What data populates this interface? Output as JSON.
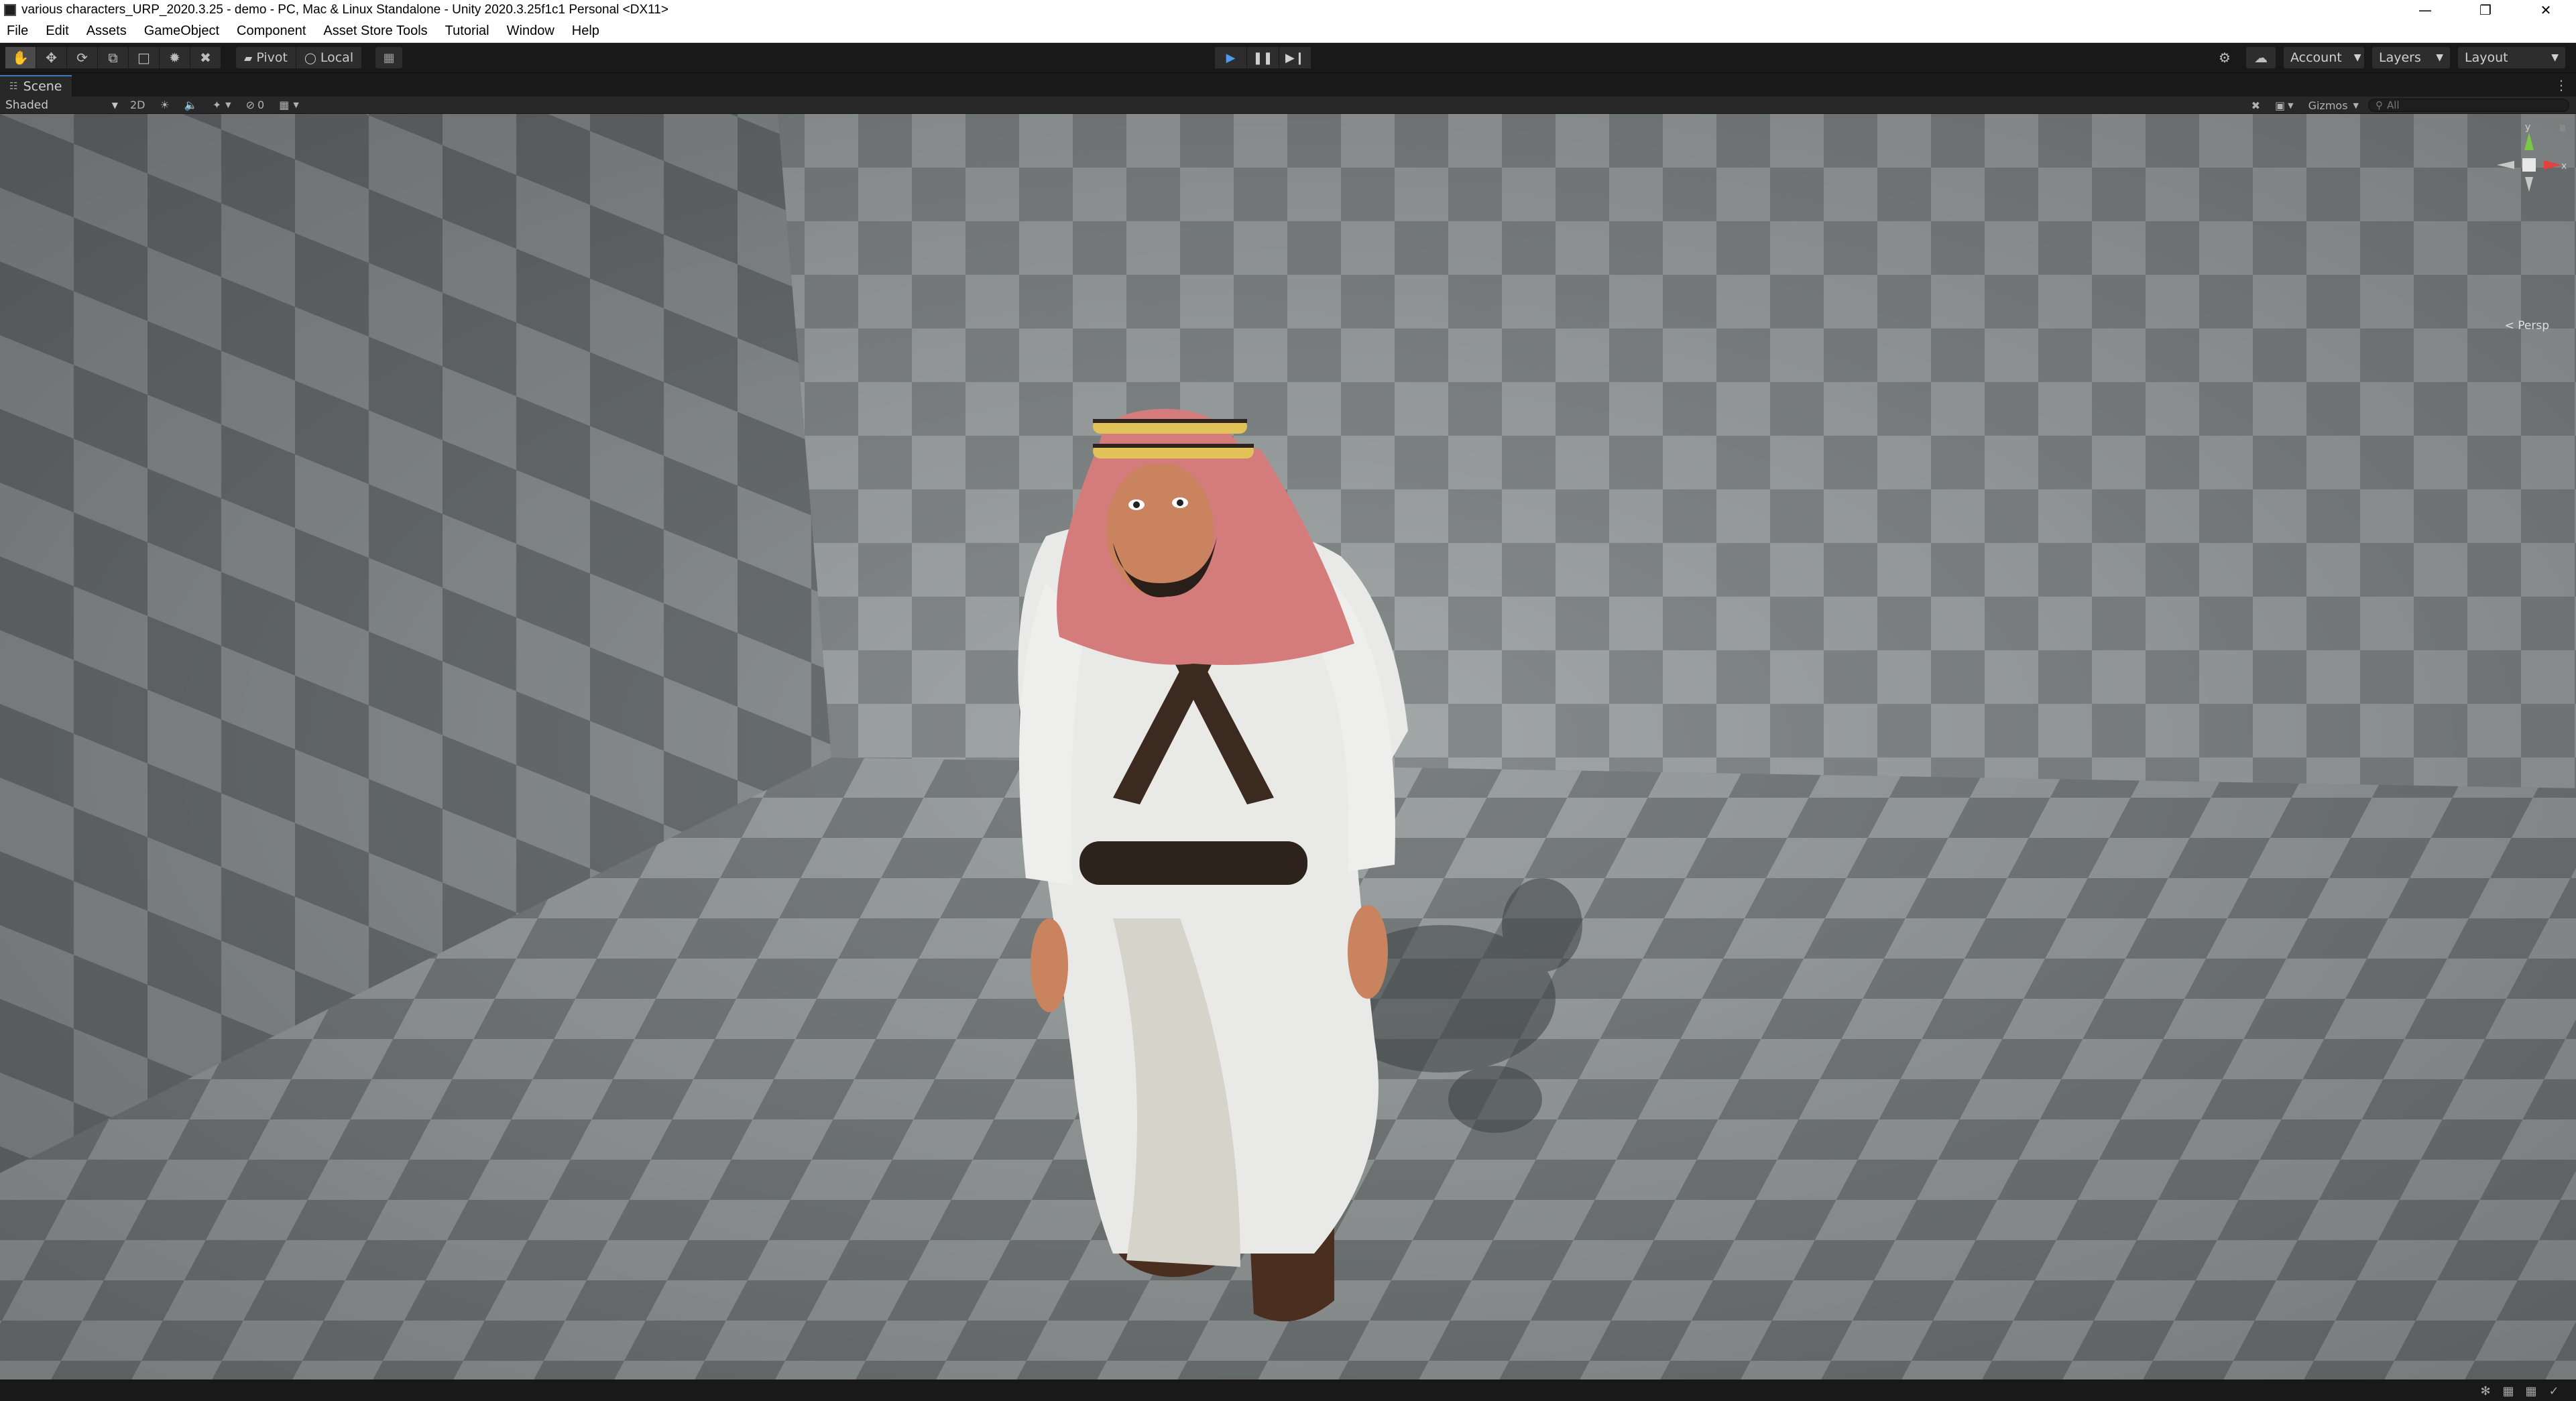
{
  "window": {
    "title": "various characters_URP_2020.3.25 - demo - PC, Mac & Linux Standalone - Unity 2020.3.25f1c1 Personal <DX11>",
    "controls": [
      "—",
      "❐",
      "✕"
    ]
  },
  "menu": [
    "File",
    "Edit",
    "Assets",
    "GameObject",
    "Component",
    "Asset Store Tools",
    "Tutorial",
    "Window",
    "Help"
  ],
  "toolbar": {
    "pivot_label": "Pivot",
    "local_label": "Local",
    "account_label": "Account",
    "layers_label": "Layers",
    "layout_label": "Layout"
  },
  "scene_tab": {
    "label": "Scene"
  },
  "scene_toolbar": {
    "draw_mode": "Shaded",
    "mode_2d": "2D",
    "hidden_count": "0",
    "gizmos_label": "Gizmos",
    "search_placeholder": "All"
  },
  "gizmo": {
    "projection_label": "< Persp",
    "axis_y": "y",
    "axis_x": "x"
  },
  "colors": {
    "editor_bg": "#191919",
    "panel_bg": "#282828",
    "accent_tab": "#3a79bb",
    "play_blue": "#4c9bf0",
    "checker_light": "#a3a8a8",
    "checker_dark": "#6c7173"
  }
}
